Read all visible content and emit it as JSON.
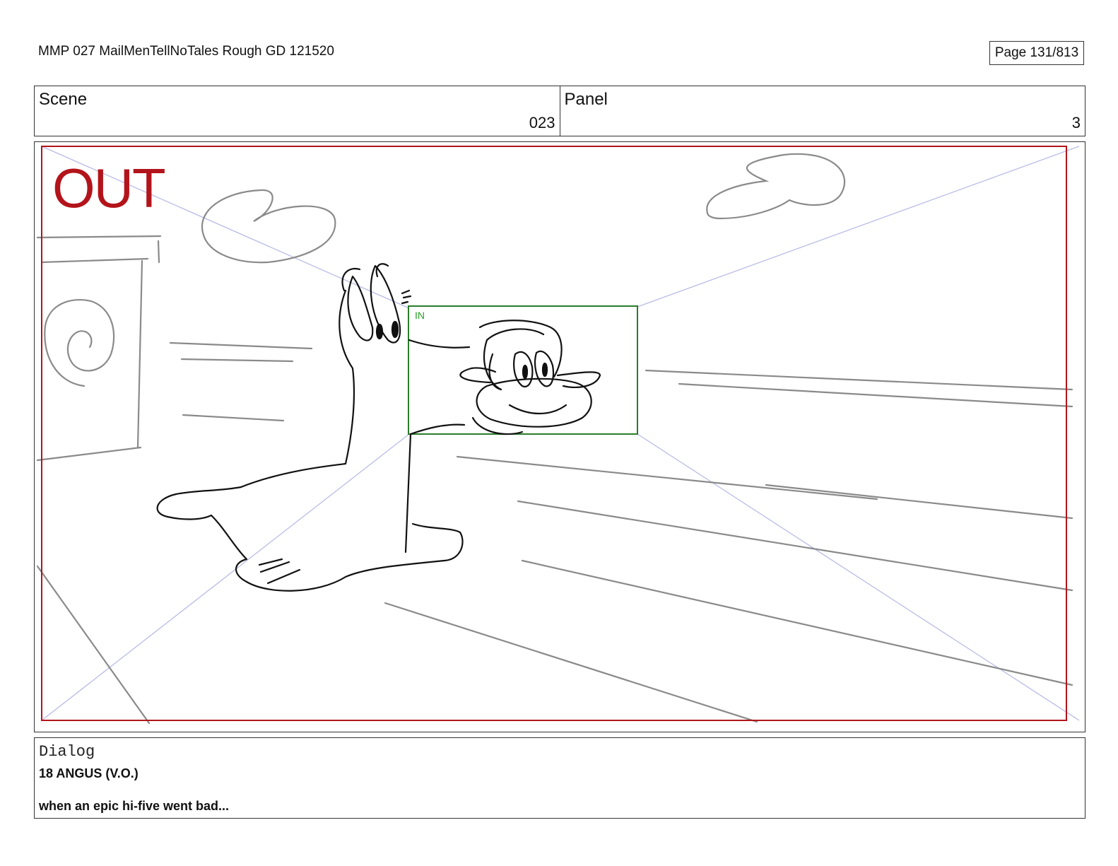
{
  "header": {
    "document_title": "MMP 027 MailMenTellNoTales Rough GD 121520",
    "page_indicator": "Page 131/813"
  },
  "scene": {
    "label": "Scene",
    "value": "023"
  },
  "panel": {
    "label": "Panel",
    "value": "3"
  },
  "frame": {
    "out_label": "OUT",
    "in_label": "IN",
    "colors": {
      "out_frame": "#b3141b",
      "in_frame": "#2a7d2a",
      "guides": "#b9bce6",
      "sketch": "#111111",
      "background_sketch": "#8a8a8a"
    },
    "illustration": "sketch-seal-character"
  },
  "dialog": {
    "heading": "Dialog",
    "speaker": "18 ANGUS (V.O.)",
    "line": "when an epic hi-five went bad..."
  }
}
